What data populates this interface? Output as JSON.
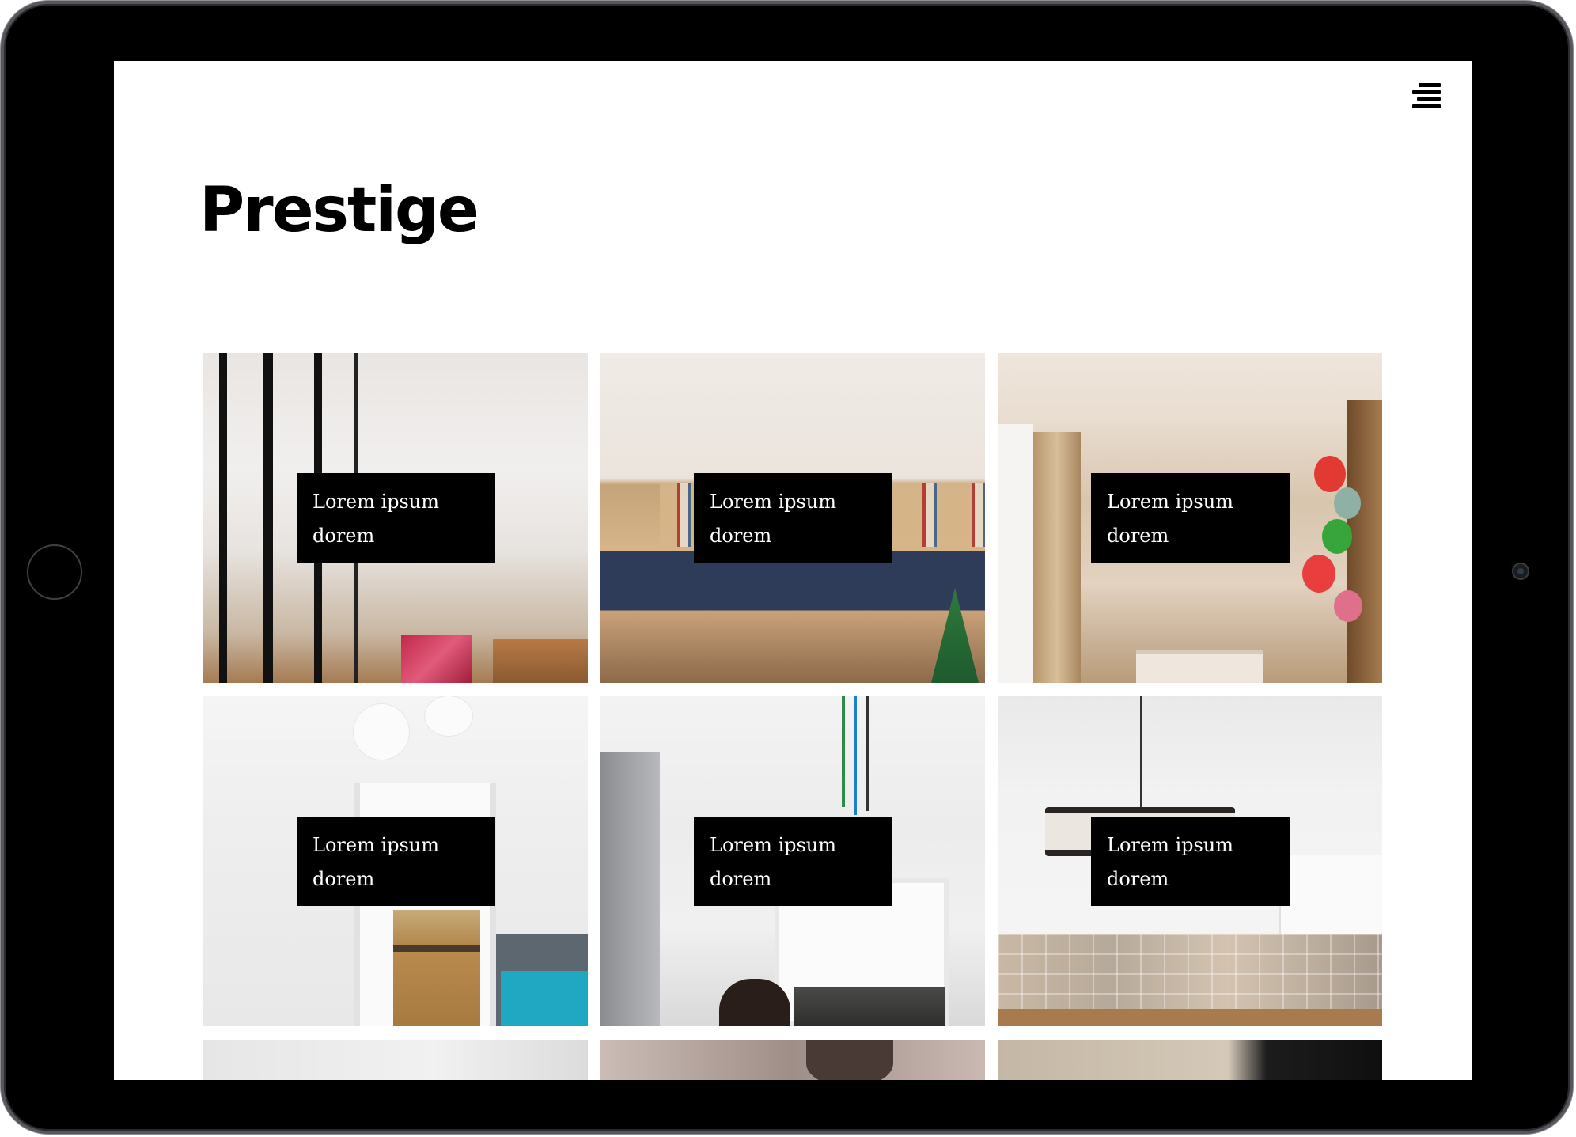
{
  "device": {
    "type": "tablet",
    "frame_color": "#000000"
  },
  "header": {
    "logo_text": "Prestige",
    "menu_icon": "menu-icon"
  },
  "gallery": {
    "items": [
      {
        "caption_line1": "Lorem ipsum",
        "caption_line2": "dorem",
        "scene": "hallway-kitchen-glass-partition"
      },
      {
        "caption_line1": "Lorem ipsum",
        "caption_line2": "dorem",
        "scene": "living-room-bookshelf"
      },
      {
        "caption_line1": "Lorem ipsum",
        "caption_line2": "dorem",
        "scene": "living-room-fireplace-balloons"
      },
      {
        "caption_line1": "Lorem ipsum",
        "caption_line2": "dorem",
        "scene": "white-corridor-kitchen"
      },
      {
        "caption_line1": "Lorem ipsum",
        "caption_line2": "dorem",
        "scene": "living-room-pendant-lights"
      },
      {
        "caption_line1": "Lorem ipsum",
        "caption_line2": "dorem",
        "scene": "kitchen-tiled-backsplash"
      }
    ],
    "partial_items": [
      {
        "scene": "white-room"
      },
      {
        "scene": "dark-lamp-room"
      },
      {
        "scene": "beige-black-room"
      }
    ]
  },
  "colors": {
    "caption_background": "#000000",
    "caption_text": "#ffffff",
    "page_background": "#ffffff"
  }
}
